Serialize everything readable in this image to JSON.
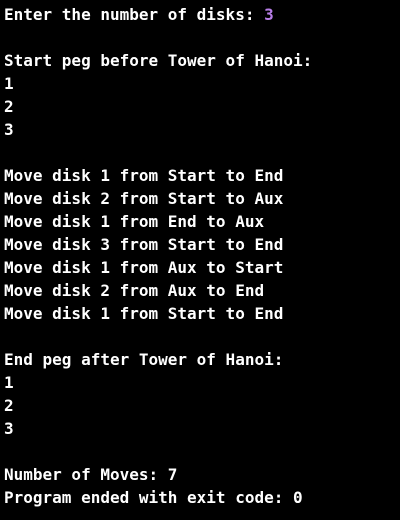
{
  "prompt": {
    "label": "Enter the number of disks: ",
    "input_value": "3"
  },
  "start_peg": {
    "heading": "Start peg before Tower of Hanoi:",
    "disks": [
      "1",
      "2",
      "3"
    ]
  },
  "moves": [
    "Move disk 1 from Start to End",
    "Move disk 2 from Start to Aux",
    "Move disk 1 from End to Aux",
    "Move disk 3 from Start to End",
    "Move disk 1 from Aux to Start",
    "Move disk 2 from Aux to End",
    "Move disk 1 from Start to End"
  ],
  "end_peg": {
    "heading": "End peg after Tower of Hanoi:",
    "disks": [
      "1",
      "2",
      "3"
    ]
  },
  "summary": {
    "moves_count": "Number of Moves: 7",
    "exit_message": "Program ended with exit code: 0"
  },
  "colors": {
    "background": "#000000",
    "text": "#ffffff",
    "user_input": "#b87ee8"
  }
}
